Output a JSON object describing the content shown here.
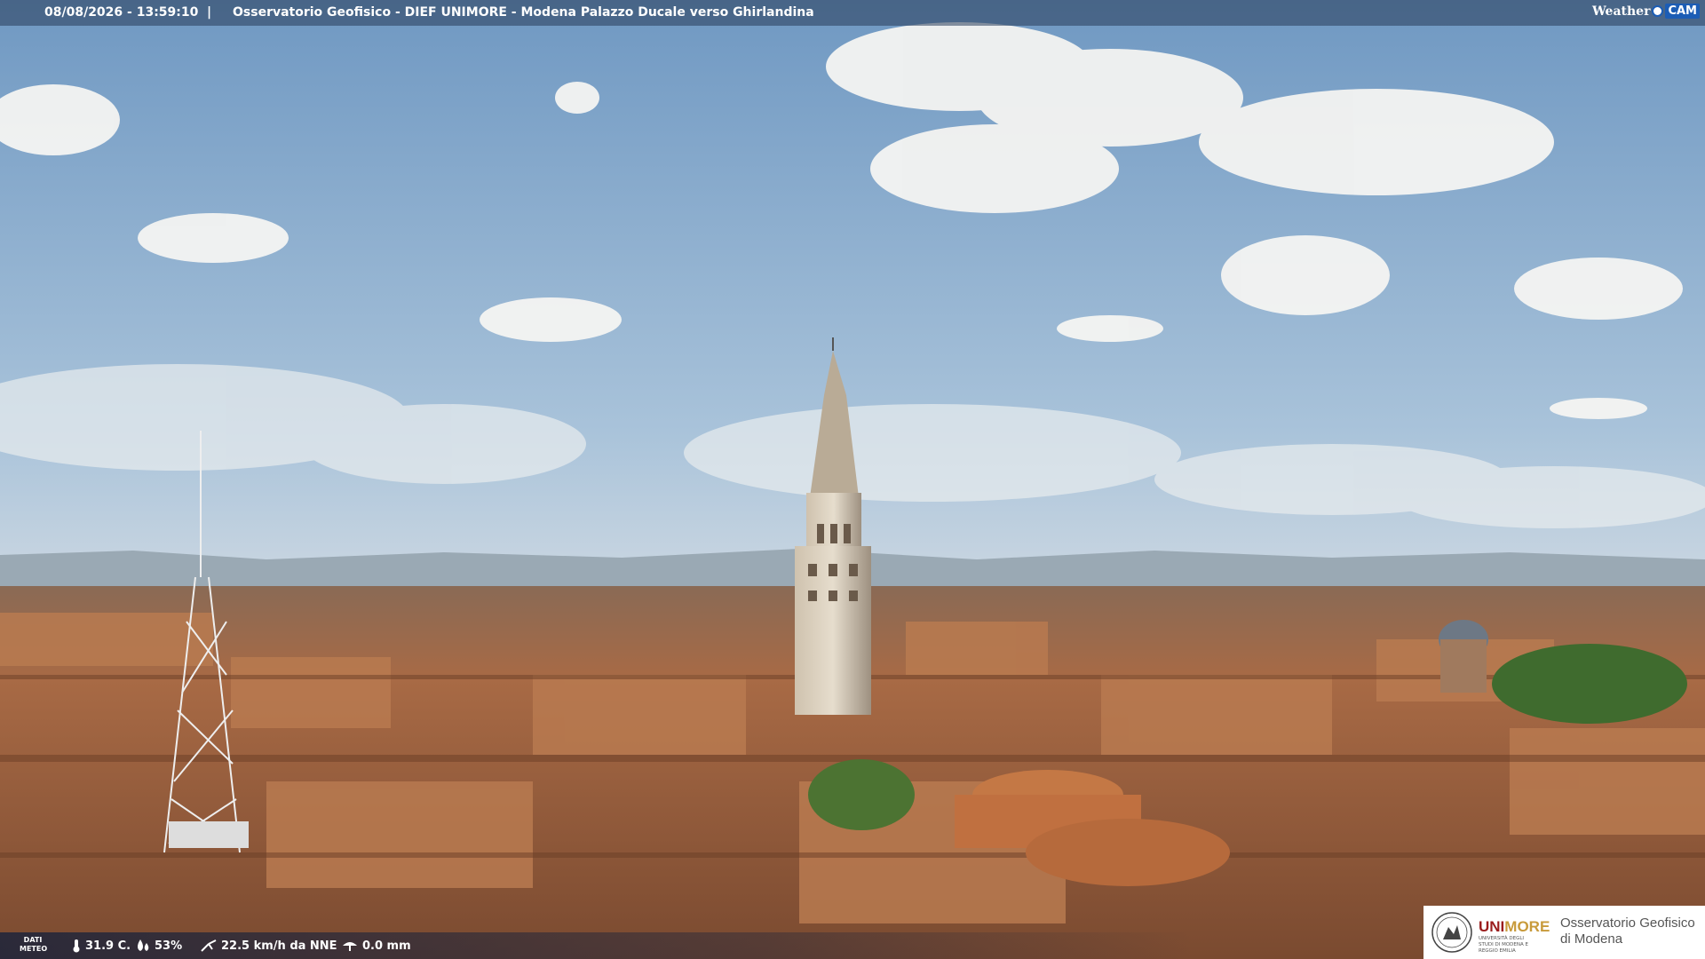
{
  "header": {
    "datetime": "08/08/2026 - 13:59:10",
    "separator": "|",
    "location": "Osservatorio Geofisico - DIEF UNIMORE - Modena Palazzo Ducale verso Ghirlandina"
  },
  "brand": {
    "weather": "Weather",
    "cam": "CAM"
  },
  "footer": {
    "label_line1": "DATI",
    "label_line2": "METEO",
    "temperature": "31.9 C.",
    "humidity": "53%",
    "wind": "22.5 km/h da NNE",
    "rain": "0.0 mm",
    "icons": [
      "thermometer-icon",
      "humidity-drop-icon",
      "wind-icon",
      "rain-gauge-icon"
    ]
  },
  "logo": {
    "uni_a": "UNI",
    "uni_b": "MORE",
    "uni_sub": "UNIVERSITÀ DEGLI STUDI DI MODENA E REGGIO EMILIA",
    "obs_line1": "Osservatorio Geofisico",
    "obs_line2": "di Modena"
  },
  "colors": {
    "sky_top": "#7fa6c9",
    "roof": "#a8653f",
    "brand_blue": "#1c5db5",
    "unimore_red": "#9a1c1c"
  }
}
